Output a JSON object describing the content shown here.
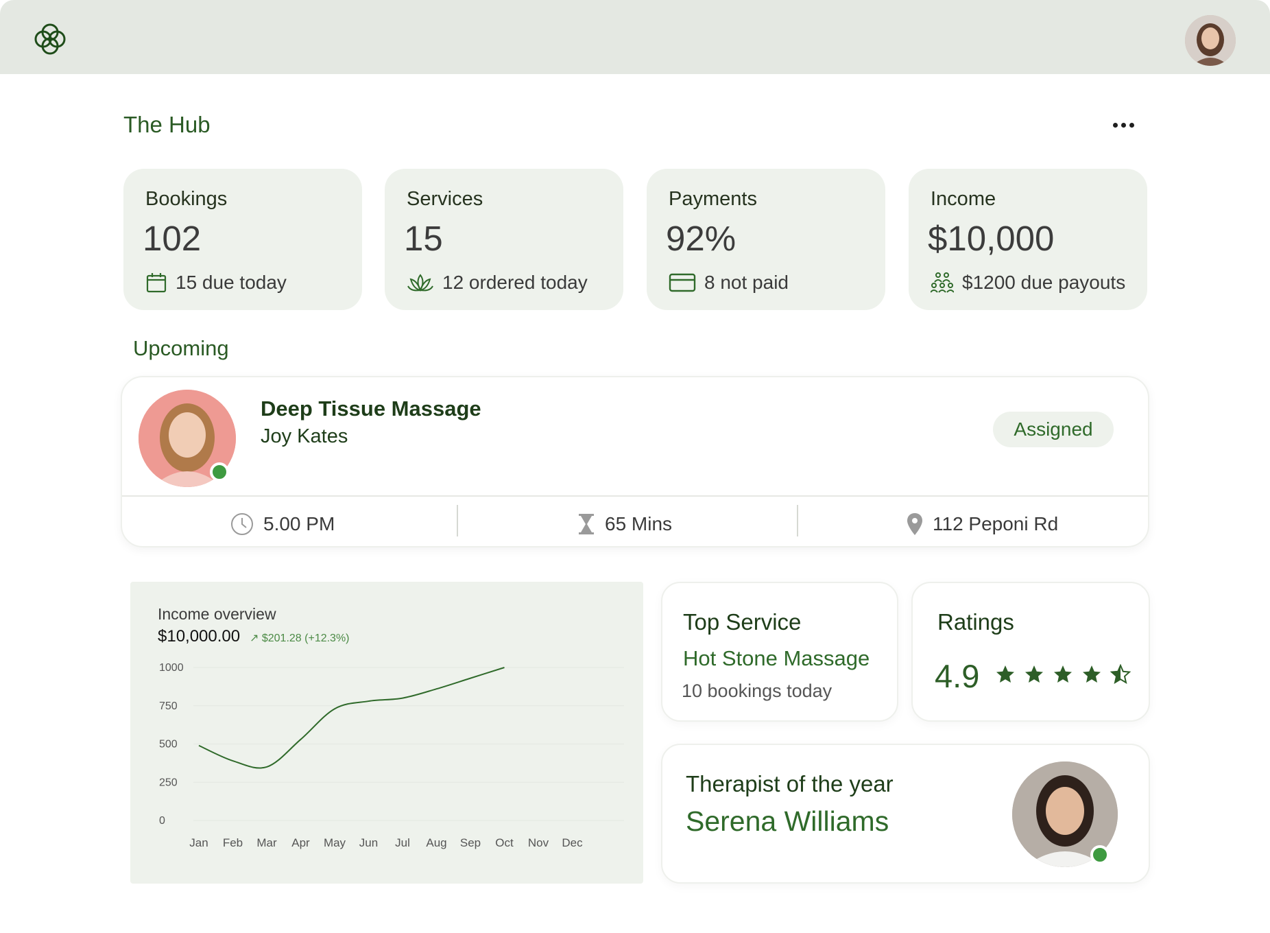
{
  "page": {
    "title": "The Hub"
  },
  "header": {
    "logo": "flower-logo-icon",
    "avatar": "user-avatar"
  },
  "stats": [
    {
      "label": "Bookings",
      "value": "102",
      "sub": "15 due today",
      "icon": "calendar-icon"
    },
    {
      "label": "Services",
      "value": "15",
      "sub": "12 ordered today",
      "icon": "lotus-icon"
    },
    {
      "label": "Payments",
      "value": "92%",
      "sub": "8 not paid",
      "icon": "credit-card-icon"
    },
    {
      "label": "Income",
      "value": "$10,000",
      "sub": "$1200 due payouts",
      "icon": "people-icon"
    }
  ],
  "upcoming": {
    "title": "Upcoming",
    "service": "Deep Tissue Massage",
    "client": "Joy Kates",
    "status": "Assigned",
    "time": "5.00 PM",
    "duration": "65 Mins",
    "location": "112 Peponi Rd"
  },
  "income_overview": {
    "title": "Income overview",
    "total": "$10,000.00",
    "change": "$201.28 (+12.3%)"
  },
  "chart_data": {
    "type": "line",
    "title": "Income overview",
    "categories": [
      "Jan",
      "Feb",
      "Mar",
      "Apr",
      "May",
      "Jun",
      "Jul",
      "Aug",
      "Sep",
      "Oct",
      "Nov",
      "Dec"
    ],
    "y_ticks": [
      "1000",
      "750",
      "500",
      "250",
      "0"
    ],
    "ylim": [
      0,
      1000
    ],
    "series": [
      {
        "values": [
          490,
          390,
          350,
          530,
          730,
          780,
          800,
          860,
          930,
          1000
        ]
      }
    ],
    "grid": true,
    "line_color": "#2f6a2a"
  },
  "top_service": {
    "title": "Top Service",
    "name": "Hot Stone Massage",
    "sub": "10 bookings today"
  },
  "ratings": {
    "title": "Ratings",
    "value": "4.9",
    "stars": 4.5
  },
  "therapist": {
    "title": "Therapist of the year",
    "name": "Serena Williams"
  },
  "colors": {
    "accent": "#2f6a2a",
    "card_bg": "#eef2ec",
    "header_bg": "#e4e8e2",
    "online": "#3e9a40"
  }
}
